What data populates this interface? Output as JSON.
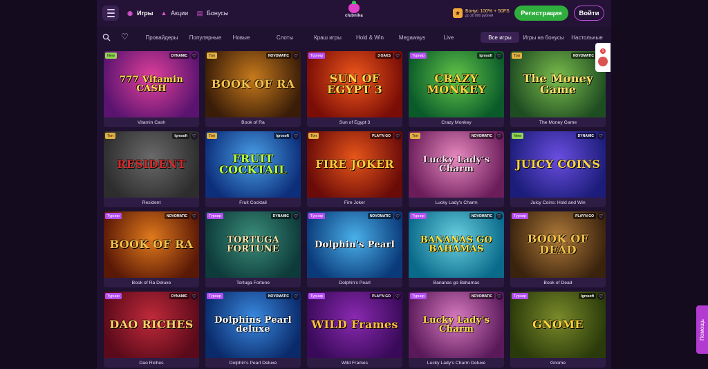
{
  "header": {
    "nav": [
      {
        "label": "Игры",
        "icon": "games-icon"
      },
      {
        "label": "Акции",
        "icon": "fire-icon"
      },
      {
        "label": "Бонусы",
        "icon": "gift-icon"
      }
    ],
    "logo_text": "clubnika",
    "bonus_line1": "Бонус 100% + 50FS",
    "bonus_line2": "до 20 000 рублей",
    "register_label": "Регистрация",
    "login_label": "Войти"
  },
  "categories": [
    "Провайдеры",
    "Популярные",
    "Новые",
    "Слоты",
    "Краш игры",
    "Hold & Win",
    "Megaways",
    "Live",
    "Все игры",
    "Игры на бонусы",
    "Настольные"
  ],
  "active_category": "Все игры",
  "games": [
    {
      "title": "Vitamin Cash",
      "art": "777 Vitamin CASH",
      "badge": "New",
      "provider": "DYNAMIC",
      "bg": [
        "#5a1470",
        "#e0409a"
      ],
      "fg": "#ffe14a"
    },
    {
      "title": "Book of Ra",
      "art": "BOOK OF RA",
      "badge": "Топ",
      "provider": "NOVOMATIC",
      "bg": [
        "#3a1d08",
        "#c77a1c"
      ],
      "fg": "#f4c24d"
    },
    {
      "title": "Sun of Egypt 3",
      "art": "SUN OF EGYPT 3",
      "badge": "Турнир",
      "provider": "3 OAKS",
      "bg": [
        "#7a0d06",
        "#f0581c"
      ],
      "fg": "#ffd74a"
    },
    {
      "title": "Crazy Monkey",
      "art": "CRAZY MONKEY",
      "badge": "Турнир",
      "provider": "Igrosoft",
      "bg": [
        "#0a5a2a",
        "#62c548"
      ],
      "fg": "#ffd23a"
    },
    {
      "title": "The Money Game",
      "art": "The Money Game",
      "badge": "Топ",
      "provider": "NOVOMATIC",
      "bg": [
        "#1f4d22",
        "#7bbd4c"
      ],
      "fg": "#ffe36a"
    },
    {
      "title": "Resident",
      "art": "RESIDENT",
      "badge": "Топ",
      "provider": "Igrosoft",
      "bg": [
        "#2d2d2d",
        "#6a6a6a"
      ],
      "fg": "#d42a2a"
    },
    {
      "title": "Fruit Cocktail",
      "art": "FRUIT COCKTAIL",
      "badge": "Топ",
      "provider": "Igrosoft",
      "bg": [
        "#0d2e7a",
        "#49a0e8"
      ],
      "fg": "#b7ff3c"
    },
    {
      "title": "Fire Joker",
      "art": "FIRE JOKER",
      "badge": "Топ",
      "provider": "PLAY'N GO",
      "bg": [
        "#6a0b08",
        "#e8561a"
      ],
      "fg": "#ffcc3a"
    },
    {
      "title": "Lucky Lady's Charm",
      "art": "Lucky Lady's Charm",
      "badge": "Топ",
      "provider": "NOVOMATIC",
      "bg": [
        "#6b1d5a",
        "#e88ac0"
      ],
      "fg": "#ffe1f0"
    },
    {
      "title": "Juicy Coins: Hold and Win",
      "art": "JUICY COINS",
      "badge": "New",
      "provider": "DYNAMIC",
      "bg": [
        "#1c1d7a",
        "#6a4ee0"
      ],
      "fg": "#ffd83a"
    },
    {
      "title": "Book of Ra Deluxe",
      "art": "BOOK OF RA",
      "badge": "Турнир",
      "provider": "NOVOMATIC",
      "bg": [
        "#5a1806",
        "#e07a1c"
      ],
      "fg": "#f4c24d"
    },
    {
      "title": "Tortuga Fortune",
      "art": "TORTUGA FORTUNE",
      "badge": "Турнир",
      "provider": "DYNAMIC",
      "bg": [
        "#0d3a3a",
        "#3b8e7a"
      ],
      "fg": "#f2e3a8"
    },
    {
      "title": "Dolphin's Pearl",
      "art": "Dolphin's Pearl",
      "badge": "Турнир",
      "provider": "NOVOMATIC",
      "bg": [
        "#0a3a7a",
        "#4ab0e8"
      ],
      "fg": "#ffffff"
    },
    {
      "title": "Bananas go Bahamas",
      "art": "BANANAS GO BAHAMAS",
      "badge": "Турнир",
      "provider": "NOVOMATIC",
      "bg": [
        "#0a6a8a",
        "#6ad0e0"
      ],
      "fg": "#ffe23a"
    },
    {
      "title": "Book of Dead",
      "art": "BOOK OF DEAD",
      "badge": "Турнир",
      "provider": "PLAY'N GO",
      "bg": [
        "#3a230d",
        "#b07a3a"
      ],
      "fg": "#f0c048"
    },
    {
      "title": "Dao Riches",
      "art": "DAO RICHES",
      "badge": "Турнир",
      "provider": "DYNAMIC",
      "bg": [
        "#5a0a1a",
        "#c02a3a"
      ],
      "fg": "#ffd36a"
    },
    {
      "title": "Dolphin's Pearl Deluxe",
      "art": "Dolphins Pearl deluxe",
      "badge": "Турнир",
      "provider": "NOVOMATIC",
      "bg": [
        "#0a2a6a",
        "#3a8ae0"
      ],
      "fg": "#ffffff"
    },
    {
      "title": "Wild Frames",
      "art": "WILD Frames",
      "badge": "Турнир",
      "provider": "PLAY'N GO",
      "bg": [
        "#3a0a5a",
        "#8a2ab0"
      ],
      "fg": "#ffc23a"
    },
    {
      "title": "Lucky Lady's Charm Deluxe",
      "art": "Lucky Lady's Charm",
      "badge": "Турнир",
      "provider": "NOVOMATIC",
      "bg": [
        "#5a1a5a",
        "#d87ac0"
      ],
      "fg": "#ffe14a"
    },
    {
      "title": "Gnome",
      "art": "GNOME",
      "badge": "Турнир",
      "provider": "Igrosoft",
      "bg": [
        "#2a3a0a",
        "#7a8a2a"
      ],
      "fg": "#ffd23a"
    }
  ],
  "help_label": "Помощь",
  "notification_count": "1",
  "colors": {
    "accent": "#c150e0",
    "register": "#2fae3e",
    "background": "#1f1130"
  }
}
